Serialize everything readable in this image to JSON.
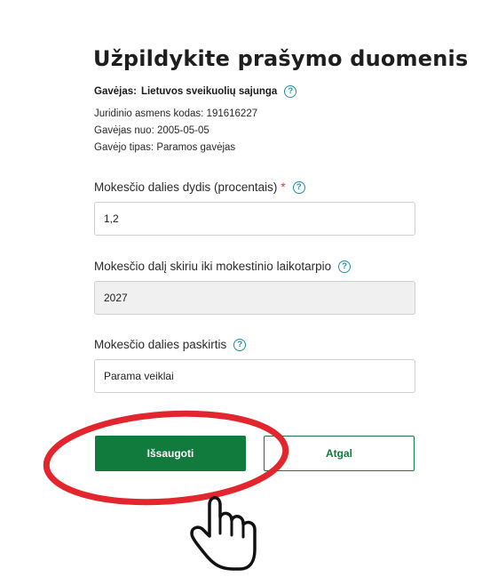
{
  "title": "Užpildykite prašymo duomenis",
  "recipient": {
    "label": "Gavėjas:",
    "name": "Lietuvos sveikuolių sajunga",
    "details": [
      "Juridinio asmens kodas: 191616227",
      "Gavėjas nuo: 2005-05-05",
      "Gavėjo tipas: Paramos gavėjas"
    ]
  },
  "form": {
    "percentage": {
      "label": "Mokesčio dalies dydis (procentais)",
      "required_mark": "*",
      "value": "1,2"
    },
    "period": {
      "label": "Mokesčio dalį skiriu iki mokestinio laikotarpio",
      "value": "2027"
    },
    "purpose": {
      "label": "Mokesčio dalies paskirtis",
      "value": "Parama veiklai"
    }
  },
  "buttons": {
    "save": "Išsaugoti",
    "back": "Atgal"
  },
  "help_glyph": "?",
  "colors": {
    "primary_green": "#117a3d",
    "help_teal": "#1f8f9f",
    "required_red": "#d83b3b",
    "highlight_red": "#e3262e"
  },
  "icons": [
    "help-icon",
    "hand-pointer-icon"
  ]
}
